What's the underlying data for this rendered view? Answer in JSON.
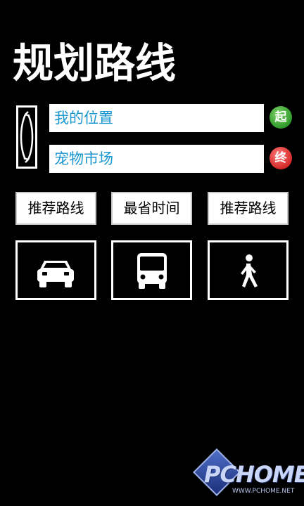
{
  "header": {
    "title": "规划路线"
  },
  "route": {
    "origin": "我的位置",
    "destination": "宠物市场",
    "start_marker": "起",
    "end_marker": "终",
    "swap_icon": "swap-icon"
  },
  "options": [
    {
      "label": "推荐路线"
    },
    {
      "label": "最省时间"
    },
    {
      "label": "推荐路线"
    }
  ],
  "modes": [
    {
      "icon": "car-icon"
    },
    {
      "icon": "bus-icon"
    },
    {
      "icon": "walk-icon"
    }
  ],
  "watermark": {
    "brand": "PCHOME",
    "url": "WWW.PCHOME.NET"
  },
  "colors": {
    "background": "#000000",
    "field_text": "#1a96d0",
    "start_marker": "#2f9a2b",
    "end_marker": "#d62a2a"
  }
}
